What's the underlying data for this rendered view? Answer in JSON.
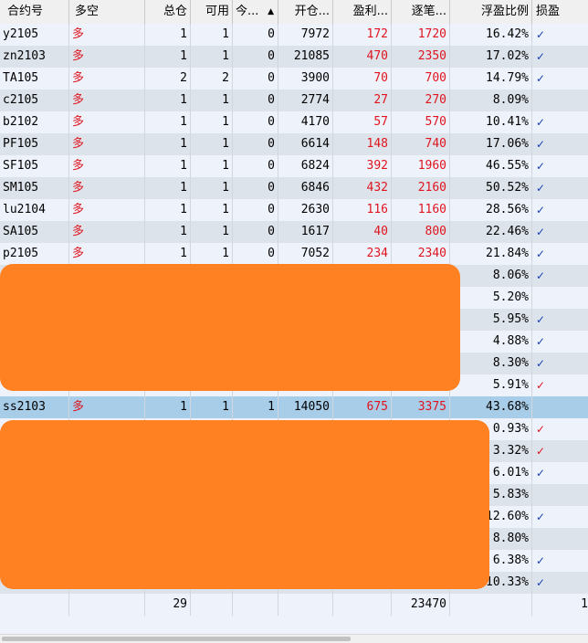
{
  "columns": [
    "合约号",
    "多空",
    "总仓",
    "可用",
    "今...",
    "开仓...",
    "盈利...",
    "逐笔...",
    "浮盈比例",
    "损盈"
  ],
  "rows": [
    {
      "contract": "y2105",
      "dir": "多",
      "total": "1",
      "avail": "1",
      "today": "0",
      "open": "7972",
      "profit": "172",
      "per": "1720",
      "ratio": "16.42%",
      "flag": "✓",
      "flag_color": "blue",
      "style": "even"
    },
    {
      "contract": "zn2103",
      "dir": "多",
      "total": "1",
      "avail": "1",
      "today": "0",
      "open": "21085",
      "profit": "470",
      "per": "2350",
      "ratio": "17.02%",
      "flag": "✓",
      "flag_color": "blue",
      "style": "odd"
    },
    {
      "contract": "TA105",
      "dir": "多",
      "total": "2",
      "avail": "2",
      "today": "0",
      "open": "3900",
      "profit": "70",
      "per": "700",
      "ratio": "14.79%",
      "flag": "✓",
      "flag_color": "blue",
      "style": "even"
    },
    {
      "contract": "c2105",
      "dir": "多",
      "total": "1",
      "avail": "1",
      "today": "0",
      "open": "2774",
      "profit": "27",
      "per": "270",
      "ratio": "8.09%",
      "flag": "",
      "flag_color": "blue",
      "style": "odd"
    },
    {
      "contract": "b2102",
      "dir": "多",
      "total": "1",
      "avail": "1",
      "today": "0",
      "open": "4170",
      "profit": "57",
      "per": "570",
      "ratio": "10.41%",
      "flag": "✓",
      "flag_color": "blue",
      "style": "even"
    },
    {
      "contract": "PF105",
      "dir": "多",
      "total": "1",
      "avail": "1",
      "today": "0",
      "open": "6614",
      "profit": "148",
      "per": "740",
      "ratio": "17.06%",
      "flag": "✓",
      "flag_color": "blue",
      "style": "odd"
    },
    {
      "contract": "SF105",
      "dir": "多",
      "total": "1",
      "avail": "1",
      "today": "0",
      "open": "6824",
      "profit": "392",
      "per": "1960",
      "ratio": "46.55%",
      "flag": "✓",
      "flag_color": "blue",
      "style": "even"
    },
    {
      "contract": "SM105",
      "dir": "多",
      "total": "1",
      "avail": "1",
      "today": "0",
      "open": "6846",
      "profit": "432",
      "per": "2160",
      "ratio": "50.52%",
      "flag": "✓",
      "flag_color": "blue",
      "style": "odd"
    },
    {
      "contract": "lu2104",
      "dir": "多",
      "total": "1",
      "avail": "1",
      "today": "0",
      "open": "2630",
      "profit": "116",
      "per": "1160",
      "ratio": "28.56%",
      "flag": "✓",
      "flag_color": "blue",
      "style": "even"
    },
    {
      "contract": "SA105",
      "dir": "多",
      "total": "1",
      "avail": "1",
      "today": "0",
      "open": "1617",
      "profit": "40",
      "per": "800",
      "ratio": "22.46%",
      "flag": "✓",
      "flag_color": "blue",
      "style": "odd"
    },
    {
      "contract": "p2105",
      "dir": "多",
      "total": "1",
      "avail": "1",
      "today": "0",
      "open": "7052",
      "profit": "234",
      "per": "2340",
      "ratio": "21.84%",
      "flag": "✓",
      "flag_color": "blue",
      "style": "even"
    },
    {
      "contract": "",
      "dir": "",
      "total": "",
      "avail": "",
      "today": "",
      "open": "",
      "profit": "",
      "per": "",
      "ratio": "8.06%",
      "flag": "✓",
      "flag_color": "blue",
      "style": "odd"
    },
    {
      "contract": "",
      "dir": "",
      "total": "",
      "avail": "",
      "today": "",
      "open": "",
      "profit": "",
      "per": "",
      "ratio": "5.20%",
      "flag": "",
      "flag_color": "blue",
      "style": "even"
    },
    {
      "contract": "",
      "dir": "",
      "total": "",
      "avail": "",
      "today": "",
      "open": "",
      "profit": "",
      "per": "",
      "ratio": "5.95%",
      "flag": "✓",
      "flag_color": "blue",
      "style": "odd"
    },
    {
      "contract": "",
      "dir": "",
      "total": "",
      "avail": "",
      "today": "",
      "open": "",
      "profit": "",
      "per": "",
      "ratio": "4.88%",
      "flag": "✓",
      "flag_color": "blue",
      "style": "even"
    },
    {
      "contract": "",
      "dir": "",
      "total": "",
      "avail": "",
      "today": "",
      "open": "",
      "profit": "",
      "per": "",
      "ratio": "8.30%",
      "flag": "✓",
      "flag_color": "blue",
      "style": "odd"
    },
    {
      "contract": "",
      "dir": "",
      "total": "",
      "avail": "",
      "today": "",
      "open": "",
      "profit": "",
      "per": "",
      "ratio": "5.91%",
      "flag": "✓",
      "flag_color": "red",
      "style": "even"
    },
    {
      "contract": "ss2103",
      "dir": "多",
      "total": "1",
      "avail": "1",
      "today": "1",
      "open": "14050",
      "profit": "675",
      "per": "3375",
      "ratio": "43.68%",
      "flag": "",
      "flag_color": "blue",
      "style": "sel"
    },
    {
      "contract": "",
      "dir": "",
      "total": "",
      "avail": "",
      "today": "",
      "open": "",
      "profit": "",
      "per": "",
      "ratio": "0.93%",
      "flag": "✓",
      "flag_color": "red",
      "style": "even"
    },
    {
      "contract": "",
      "dir": "",
      "total": "",
      "avail": "",
      "today": "",
      "open": "",
      "profit": "",
      "per": "",
      "ratio": "3.32%",
      "flag": "✓",
      "flag_color": "red",
      "style": "odd"
    },
    {
      "contract": "",
      "dir": "",
      "total": "",
      "avail": "",
      "today": "",
      "open": "",
      "profit": "",
      "per": "",
      "ratio": "6.01%",
      "flag": "✓",
      "flag_color": "blue",
      "style": "even"
    },
    {
      "contract": "",
      "dir": "",
      "total": "",
      "avail": "",
      "today": "",
      "open": "",
      "profit": "",
      "per": "",
      "ratio": "5.83%",
      "flag": "",
      "flag_color": "blue",
      "style": "odd"
    },
    {
      "contract": "",
      "dir": "",
      "total": "",
      "avail": "",
      "today": "",
      "open": "",
      "profit": "",
      "per": "",
      "ratio": "12.60%",
      "flag": "✓",
      "flag_color": "blue",
      "style": "even"
    },
    {
      "contract": "",
      "dir": "",
      "total": "",
      "avail": "",
      "today": "",
      "open": "",
      "profit": "",
      "per": "",
      "ratio": "8.80%",
      "flag": "",
      "flag_color": "blue",
      "style": "odd"
    },
    {
      "contract": "",
      "dir": "",
      "total": "",
      "avail": "",
      "today": "",
      "open": "",
      "profit": "",
      "per": "",
      "ratio": "6.38%",
      "flag": "✓",
      "flag_color": "blue",
      "style": "even"
    },
    {
      "contract": "",
      "dir": "",
      "total": "",
      "avail": "",
      "today": "",
      "open": "",
      "profit": "",
      "per": "",
      "ratio": "10.33%",
      "flag": "✓",
      "flag_color": "blue",
      "style": "odd"
    }
  ],
  "totals": {
    "total": "29",
    "per": "23470",
    "flag": "1"
  },
  "colors": {
    "accent_red": "#e0141e",
    "check_blue": "#1a3fbf",
    "redaction": "#ff8121",
    "selected_row": "#a8cde8"
  },
  "icons": {
    "sort": "sort-ascending-icon",
    "check": "check-icon"
  }
}
